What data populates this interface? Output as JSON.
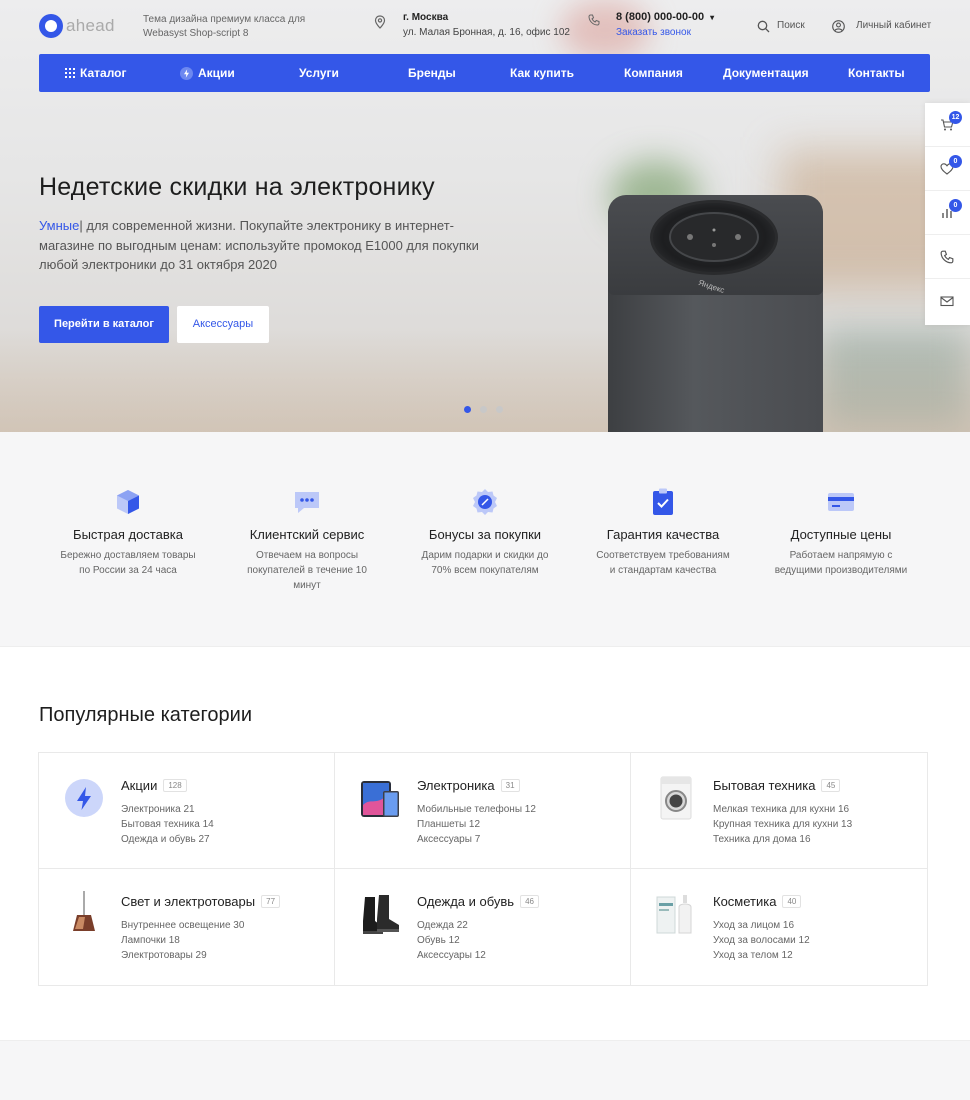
{
  "header": {
    "logo_text": "ahead",
    "tagline": "Тема дизайна премиум класса для Webasyst Shop-script 8",
    "city": "г. Москва",
    "address": "ул. Малая Бронная, д. 16, офис 102",
    "phone": "8 (800) 000-00-00",
    "callback": "Заказать звонок",
    "search_label": "Поиск",
    "account_label": "Личный кабинет"
  },
  "nav": {
    "items": [
      "Каталог",
      "Акции",
      "Услуги",
      "Бренды",
      "Как купить",
      "Компания",
      "Документация",
      "Контакты"
    ]
  },
  "side_panel": {
    "cart_count": "12",
    "favorites_count": "0",
    "compare_count": "0"
  },
  "hero": {
    "title": "Недетские скидки на электронику",
    "accent_word": "Умные",
    "text": "| для современной жизни. Покупайте электронику в интернет-магазине по выгодным ценам: используйте промокод E1000 для покупки любой электроники до 31 октября 2020",
    "primary_button": "Перейти в каталог",
    "secondary_button": "Аксессуары",
    "speaker_brand": "Яндекс"
  },
  "features": [
    {
      "title": "Быстрая доставка",
      "text": "Бережно доставляем товары по России за 24 часа"
    },
    {
      "title": "Клиентский сервис",
      "text": "Отвечаем на вопросы покупателей в течение 10 минут"
    },
    {
      "title": "Бонусы за покупки",
      "text": "Дарим подарки и скидки до 70% всем покупателям"
    },
    {
      "title": "Гарантия качества",
      "text": "Соответствуем требованиям и стандартам качества"
    },
    {
      "title": "Доступные цены",
      "text": "Работаем напрямую с ведущими производителями"
    }
  ],
  "categories": {
    "heading": "Популярные категории",
    "items": [
      {
        "title": "Акции",
        "count": "128",
        "subs": [
          "Электроника 21",
          "Бытовая техника 14",
          "Одежда и обувь 27"
        ]
      },
      {
        "title": "Электроника",
        "count": "31",
        "subs": [
          "Мобильные телефоны 12",
          "Планшеты 12",
          "Аксессуары 7"
        ]
      },
      {
        "title": "Бытовая техника",
        "count": "45",
        "subs": [
          "Мелкая техника для кухни 16",
          "Крупная техника для кухни 13",
          "Техника для дома 16"
        ]
      },
      {
        "title": "Свет и электротовары",
        "count": "77",
        "subs": [
          "Внутреннее освещение 30",
          "Лампочки 18",
          "Электротовары 29"
        ]
      },
      {
        "title": "Одежда и обувь",
        "count": "46",
        "subs": [
          "Одежда 22",
          "Обувь 12",
          "Аксессуары 12"
        ]
      },
      {
        "title": "Косметика",
        "count": "40",
        "subs": [
          "Уход за лицом 16",
          "Уход за волосами 12",
          "Уход за телом 12"
        ]
      }
    ]
  },
  "colors": {
    "accent": "#3457e8"
  }
}
